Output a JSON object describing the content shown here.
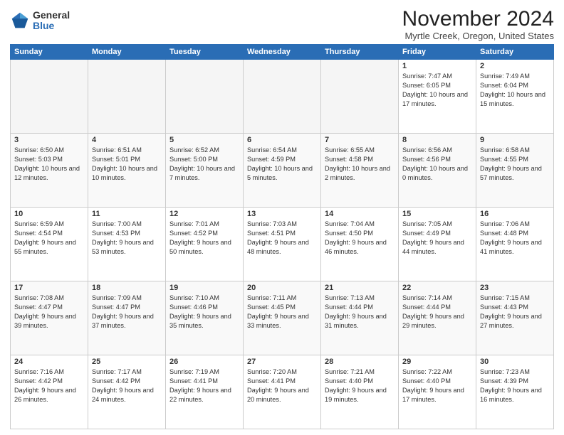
{
  "logo": {
    "general": "General",
    "blue": "Blue"
  },
  "title": "November 2024",
  "location": "Myrtle Creek, Oregon, United States",
  "days_header": [
    "Sunday",
    "Monday",
    "Tuesday",
    "Wednesday",
    "Thursday",
    "Friday",
    "Saturday"
  ],
  "weeks": [
    [
      {
        "day": "",
        "info": ""
      },
      {
        "day": "",
        "info": ""
      },
      {
        "day": "",
        "info": ""
      },
      {
        "day": "",
        "info": ""
      },
      {
        "day": "",
        "info": ""
      },
      {
        "day": "1",
        "info": "Sunrise: 7:47 AM\nSunset: 6:05 PM\nDaylight: 10 hours and 17 minutes."
      },
      {
        "day": "2",
        "info": "Sunrise: 7:49 AM\nSunset: 6:04 PM\nDaylight: 10 hours and 15 minutes."
      }
    ],
    [
      {
        "day": "3",
        "info": "Sunrise: 6:50 AM\nSunset: 5:03 PM\nDaylight: 10 hours and 12 minutes."
      },
      {
        "day": "4",
        "info": "Sunrise: 6:51 AM\nSunset: 5:01 PM\nDaylight: 10 hours and 10 minutes."
      },
      {
        "day": "5",
        "info": "Sunrise: 6:52 AM\nSunset: 5:00 PM\nDaylight: 10 hours and 7 minutes."
      },
      {
        "day": "6",
        "info": "Sunrise: 6:54 AM\nSunset: 4:59 PM\nDaylight: 10 hours and 5 minutes."
      },
      {
        "day": "7",
        "info": "Sunrise: 6:55 AM\nSunset: 4:58 PM\nDaylight: 10 hours and 2 minutes."
      },
      {
        "day": "8",
        "info": "Sunrise: 6:56 AM\nSunset: 4:56 PM\nDaylight: 10 hours and 0 minutes."
      },
      {
        "day": "9",
        "info": "Sunrise: 6:58 AM\nSunset: 4:55 PM\nDaylight: 9 hours and 57 minutes."
      }
    ],
    [
      {
        "day": "10",
        "info": "Sunrise: 6:59 AM\nSunset: 4:54 PM\nDaylight: 9 hours and 55 minutes."
      },
      {
        "day": "11",
        "info": "Sunrise: 7:00 AM\nSunset: 4:53 PM\nDaylight: 9 hours and 53 minutes."
      },
      {
        "day": "12",
        "info": "Sunrise: 7:01 AM\nSunset: 4:52 PM\nDaylight: 9 hours and 50 minutes."
      },
      {
        "day": "13",
        "info": "Sunrise: 7:03 AM\nSunset: 4:51 PM\nDaylight: 9 hours and 48 minutes."
      },
      {
        "day": "14",
        "info": "Sunrise: 7:04 AM\nSunset: 4:50 PM\nDaylight: 9 hours and 46 minutes."
      },
      {
        "day": "15",
        "info": "Sunrise: 7:05 AM\nSunset: 4:49 PM\nDaylight: 9 hours and 44 minutes."
      },
      {
        "day": "16",
        "info": "Sunrise: 7:06 AM\nSunset: 4:48 PM\nDaylight: 9 hours and 41 minutes."
      }
    ],
    [
      {
        "day": "17",
        "info": "Sunrise: 7:08 AM\nSunset: 4:47 PM\nDaylight: 9 hours and 39 minutes."
      },
      {
        "day": "18",
        "info": "Sunrise: 7:09 AM\nSunset: 4:47 PM\nDaylight: 9 hours and 37 minutes."
      },
      {
        "day": "19",
        "info": "Sunrise: 7:10 AM\nSunset: 4:46 PM\nDaylight: 9 hours and 35 minutes."
      },
      {
        "day": "20",
        "info": "Sunrise: 7:11 AM\nSunset: 4:45 PM\nDaylight: 9 hours and 33 minutes."
      },
      {
        "day": "21",
        "info": "Sunrise: 7:13 AM\nSunset: 4:44 PM\nDaylight: 9 hours and 31 minutes."
      },
      {
        "day": "22",
        "info": "Sunrise: 7:14 AM\nSunset: 4:44 PM\nDaylight: 9 hours and 29 minutes."
      },
      {
        "day": "23",
        "info": "Sunrise: 7:15 AM\nSunset: 4:43 PM\nDaylight: 9 hours and 27 minutes."
      }
    ],
    [
      {
        "day": "24",
        "info": "Sunrise: 7:16 AM\nSunset: 4:42 PM\nDaylight: 9 hours and 26 minutes."
      },
      {
        "day": "25",
        "info": "Sunrise: 7:17 AM\nSunset: 4:42 PM\nDaylight: 9 hours and 24 minutes."
      },
      {
        "day": "26",
        "info": "Sunrise: 7:19 AM\nSunset: 4:41 PM\nDaylight: 9 hours and 22 minutes."
      },
      {
        "day": "27",
        "info": "Sunrise: 7:20 AM\nSunset: 4:41 PM\nDaylight: 9 hours and 20 minutes."
      },
      {
        "day": "28",
        "info": "Sunrise: 7:21 AM\nSunset: 4:40 PM\nDaylight: 9 hours and 19 minutes."
      },
      {
        "day": "29",
        "info": "Sunrise: 7:22 AM\nSunset: 4:40 PM\nDaylight: 9 hours and 17 minutes."
      },
      {
        "day": "30",
        "info": "Sunrise: 7:23 AM\nSunset: 4:39 PM\nDaylight: 9 hours and 16 minutes."
      }
    ]
  ]
}
